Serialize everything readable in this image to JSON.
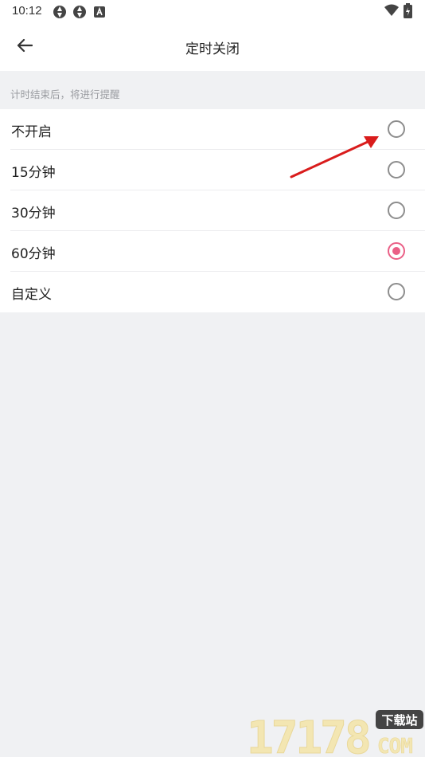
{
  "status_bar": {
    "time": "10:12",
    "icons": [
      "app-notification-icon",
      "app-notification-icon",
      "a-badge-icon",
      "wifi-icon",
      "battery-charging-icon"
    ]
  },
  "app_bar": {
    "back_icon": "arrow-left-icon",
    "title": "定时关闭"
  },
  "section": {
    "hint": "计时结束后，将进行提醒"
  },
  "options": [
    {
      "label": "不开启",
      "selected": false
    },
    {
      "label": "15分钟",
      "selected": false
    },
    {
      "label": "30分钟",
      "selected": false
    },
    {
      "label": "60分钟",
      "selected": true
    },
    {
      "label": "自定义",
      "selected": false
    }
  ],
  "colors": {
    "accent": "#ea5f86",
    "annotation_arrow": "#d91c1c",
    "background": "#f0f1f3"
  },
  "watermark": {
    "brand_number": "17178",
    "badge": "下载站",
    "suffix": "COM"
  }
}
